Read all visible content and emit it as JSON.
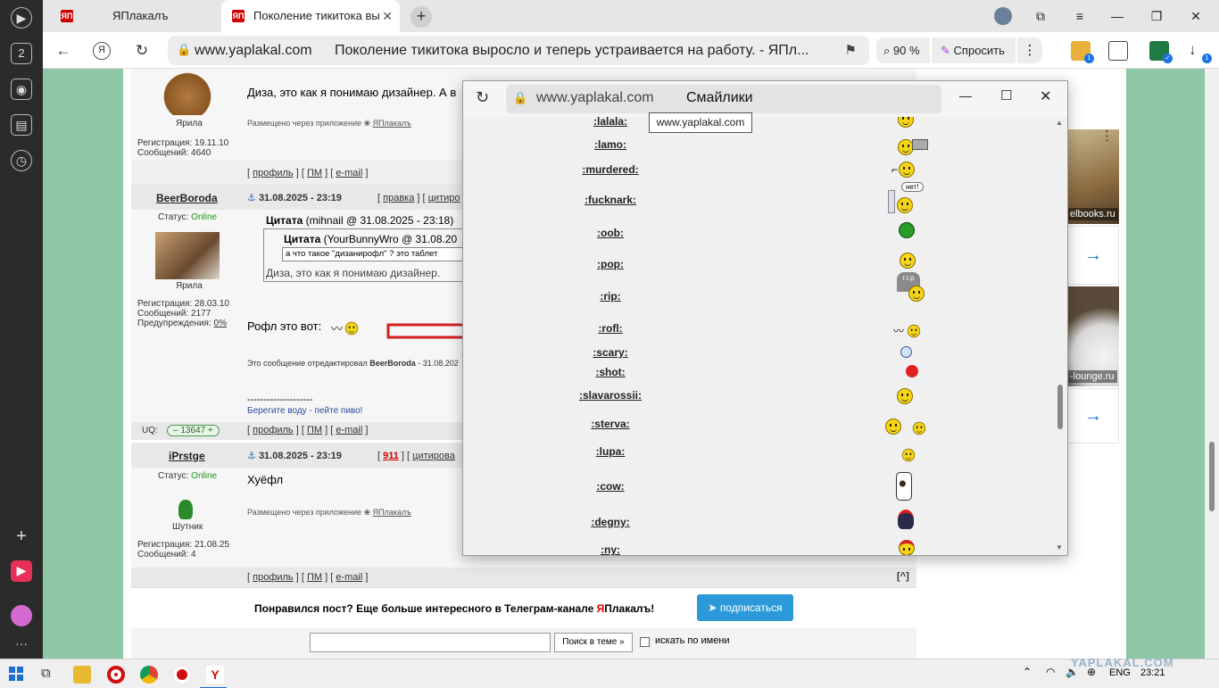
{
  "tabs": [
    {
      "label": "ЯПлакалъ",
      "favicon": "ЯП"
    },
    {
      "label": "Поколение тикитока вы",
      "favicon": "ЯП"
    }
  ],
  "toolbar": {
    "domain": "www.yaplakal.com",
    "page_title": "Поколение тикитока выросло и теперь устраивается на работу. - ЯПл...",
    "zoom": "90 %",
    "ask_label": "Спросить"
  },
  "posts": [
    {
      "quote_text": "Диза, это как я понимаю дизайнер. А в",
      "via_app": "Размещено через приложение",
      "app_name": "ЯПлакалъ",
      "rank": "Ярила",
      "reg_label": "Регистрация:",
      "reg": "19.11.10",
      "msgs_label": "Сообщений:",
      "msgs": "4640"
    },
    {
      "nick": "BeerBoroda",
      "date": "31.08.2025 - 23:19",
      "status_label": "Статус:",
      "status": "Online",
      "rank": "Ярила",
      "reg_label": "Регистрация:",
      "reg": "28.03.10",
      "msgs_label": "Сообщений:",
      "msgs": "2177",
      "warn_label": "Предупреждения:",
      "warn": "0%",
      "quote_head": "Цитата",
      "quote_author": "(mihnail @ 31.08.2025 - 23:18)",
      "inner_quote_author": "(YourBunnyWro @ 31.08.20",
      "inner_quote_text": "а что такое \"дизанирофл\" ? это таблет",
      "quote_body": "Диза, это как я понимаю дизайнер.",
      "body": "Рофл это вот:",
      "edited": "Это сообщение отредактировал",
      "edited_by": "BeerBoroda",
      "edited_date": "- 31.08.202",
      "sig_line": "--------------------",
      "signature": "Берегите воду - пейте пиво!",
      "uq_label": "UQ:",
      "uq": "13647"
    },
    {
      "nick": "iPrstge",
      "date": "31.08.2025 - 23:19",
      "status_label": "Статус:",
      "status": "Online",
      "body": "Хуёфл",
      "via_app": "Размещено через приложение",
      "app_name": "ЯПлакалъ",
      "rank": "Шутник",
      "reg_label": "Регистрация:",
      "reg": "21.08.25",
      "msgs_label": "Сообщений:",
      "msgs": "4",
      "karma": "911"
    }
  ],
  "post_links": {
    "profile": "профиль",
    "pm": "ПМ",
    "email": "e-mail",
    "edit": "правка",
    "quote": "цитиро",
    "quote2": "цитирова",
    "top": "[^]"
  },
  "telegram": {
    "text_pre": "Понравился пост? Еще больше интересного в Телеграм-канале ",
    "brand_a": "Я",
    "brand_b": "Плакалъ",
    "text_post": "!",
    "button": "подписаться"
  },
  "search": {
    "button": "Поиск в теме »",
    "checkbox_label": "искать по имени"
  },
  "right_ads": [
    {
      "domain": "elbooks.ru"
    },
    {
      "domain": "-lounge.ru"
    }
  ],
  "popup": {
    "domain": "www.yaplakal.com",
    "title": "Смайлики",
    "tooltip": "www.yaplakal.com",
    "codes": [
      ":lalala:",
      ":lamo:",
      ":murdered:",
      ":fucknark:",
      ":oob:",
      ":pop:",
      ":rip:",
      ":rofl:",
      ":scary:",
      ":shot:",
      ":slavarossii:",
      ":sterva:",
      ":lupa:",
      ":cow:",
      ":degny:",
      ":ny:"
    ],
    "bubble_text": "нет!",
    "rip_text": "r.i.p"
  },
  "taskbar": {
    "lang": "ENG",
    "time": "23:21",
    "watermark": "YAPLAKAL.COM"
  },
  "sidebar": {
    "tab_count": "2"
  },
  "colors": {
    "page_bg": "#8ec7a6",
    "online": "#1a9a1a",
    "tg_button": "#2c9ad8",
    "arrow": "#d02020"
  }
}
